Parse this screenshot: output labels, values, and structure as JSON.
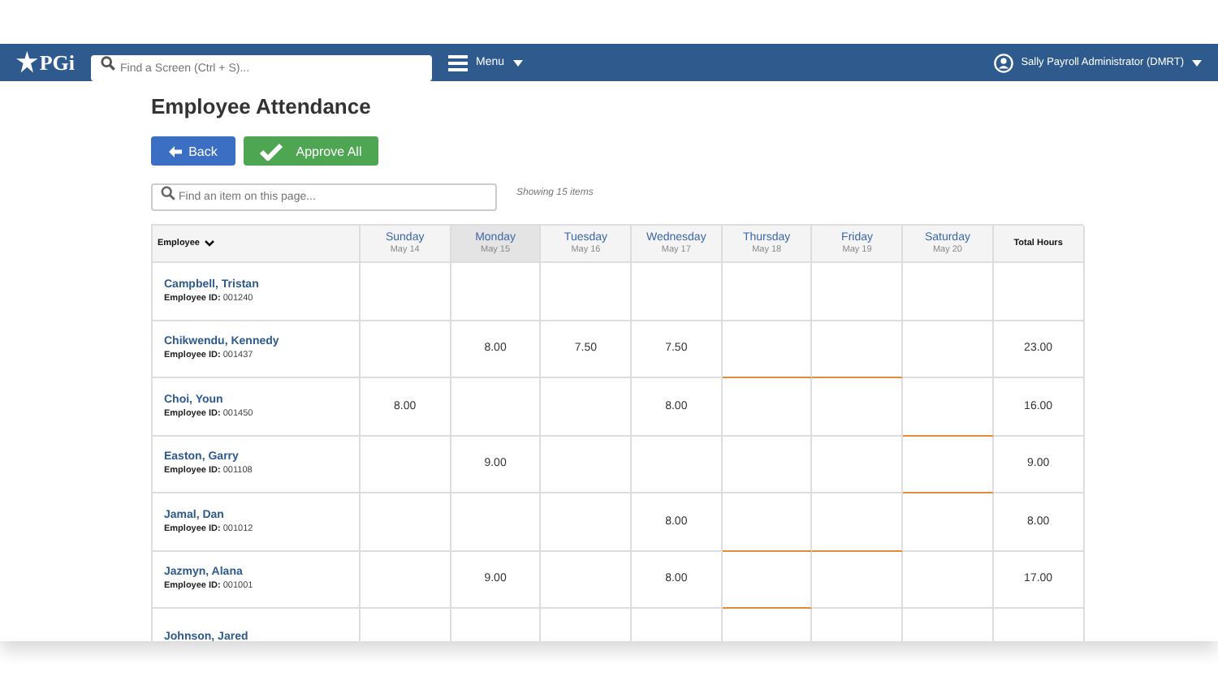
{
  "navbar": {
    "logo": "PGi",
    "search": {
      "placeholder": "Find a Screen (Ctrl + S)..."
    },
    "menu": "Menu",
    "user": "Sally Payroll Administrator (DMRT)"
  },
  "page": {
    "title": "Employee Attendance",
    "buttons": [
      {
        "kind": "back",
        "label": "Back"
      },
      {
        "kind": "approve",
        "label": "Approve All"
      }
    ],
    "filter": {
      "placeholder": "Find an item on this page..."
    },
    "count": "Showing 15 items"
  },
  "table": {
    "employee_header": "Employee",
    "total_header": "Total Hours",
    "days": [
      {
        "day": "Sunday",
        "date": "May 14",
        "selected": false
      },
      {
        "day": "Monday",
        "date": "May 15",
        "selected": true
      },
      {
        "day": "Tuesday",
        "date": "May 16",
        "selected": false
      },
      {
        "day": "Wednesday",
        "date": "May 17",
        "selected": false
      },
      {
        "day": "Thursday",
        "date": "May 18",
        "selected": false
      },
      {
        "day": "Friday",
        "date": "May 19",
        "selected": false
      },
      {
        "day": "Saturday",
        "date": "May 20",
        "selected": false
      }
    ],
    "rows": [
      {
        "name": "Campbell, Tristan",
        "id_label": "Employee ID:",
        "id": "001240",
        "cells": [
          {
            "flagged": false
          },
          {
            "flagged": false
          },
          {
            "flagged": false
          },
          {
            "flagged": false
          },
          {
            "flagged": false
          },
          {
            "flagged": false
          },
          {
            "flagged": false
          }
        ]
      },
      {
        "name": "Chikwendu, Kennedy",
        "id_label": "Employee ID:",
        "id": "001437",
        "total": "23.00",
        "cells": [
          {
            "flagged": false
          },
          {
            "hours": "8.00",
            "flagged": false
          },
          {
            "hours": "7.50",
            "flagged": false
          },
          {
            "hours": "7.50",
            "flagged": false
          },
          {
            "flagged": true
          },
          {
            "flagged": true
          },
          {
            "flagged": false
          }
        ]
      },
      {
        "name": "Choi, Youn",
        "id_label": "Employee ID:",
        "id": "001450",
        "total": "16.00",
        "cells": [
          {
            "hours": "8.00",
            "flagged": false
          },
          {
            "flagged": false
          },
          {
            "flagged": false
          },
          {
            "hours": "8.00",
            "flagged": false
          },
          {
            "flagged": false
          },
          {
            "flagged": false
          },
          {
            "flagged": true
          }
        ]
      },
      {
        "name": "Easton, Garry",
        "id_label": "Employee ID:",
        "id": "001108",
        "total": "9.00",
        "cells": [
          {
            "flagged": false
          },
          {
            "hours": "9.00",
            "flagged": false
          },
          {
            "flagged": false
          },
          {
            "flagged": false
          },
          {
            "flagged": false
          },
          {
            "flagged": false
          },
          {
            "flagged": true
          }
        ]
      },
      {
        "name": "Jamal, Dan",
        "id_label": "Employee ID:",
        "id": "001012",
        "total": "8.00",
        "cells": [
          {
            "flagged": false
          },
          {
            "flagged": false
          },
          {
            "flagged": false
          },
          {
            "hours": "8.00",
            "flagged": false
          },
          {
            "flagged": true
          },
          {
            "flagged": true
          },
          {
            "flagged": false
          }
        ]
      },
      {
        "name": "Jazmyn, Alana",
        "id_label": "Employee ID:",
        "id": "001001",
        "total": "17.00",
        "cells": [
          {
            "flagged": false
          },
          {
            "hours": "9.00",
            "flagged": false
          },
          {
            "flagged": false
          },
          {
            "hours": "8.00",
            "flagged": false
          },
          {
            "flagged": true
          },
          {
            "flagged": false
          },
          {
            "flagged": false
          }
        ]
      },
      {
        "name": "Johnson, Jared"
      }
    ]
  }
}
